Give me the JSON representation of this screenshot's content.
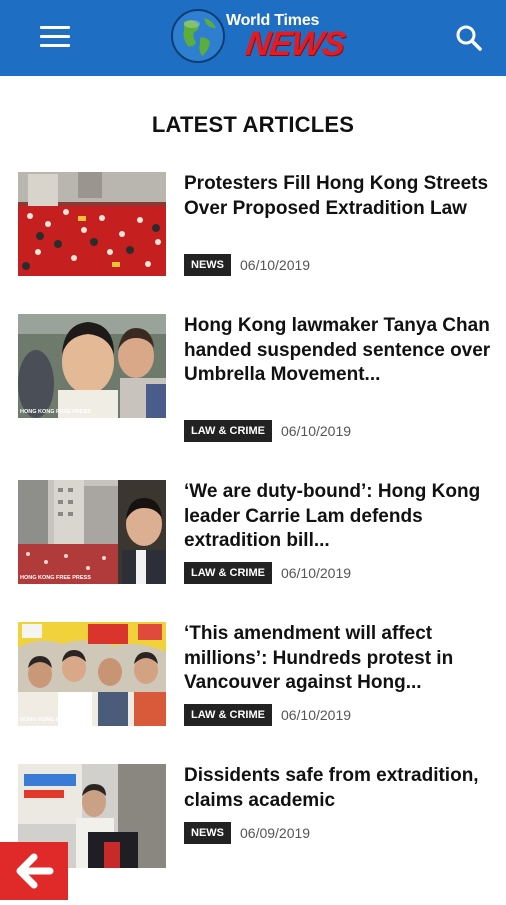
{
  "header": {
    "menu_icon": "hamburger-menu-icon",
    "logo_top": "World Times",
    "logo_news": "NEWS",
    "search_icon": "search-icon",
    "bar_color": "#1e6fc4"
  },
  "section": {
    "title": "LATEST ARTICLES"
  },
  "articles": [
    {
      "title": "Protesters Fill Hong Kong Streets Over Proposed Extradition Law",
      "category": "NEWS",
      "date": "06/10/2019",
      "thumb_caption": ""
    },
    {
      "title": "Hong Kong lawmaker Tanya Chan handed suspended sentence over Umbrella Movement...",
      "category": "LAW & CRIME",
      "date": "06/10/2019",
      "thumb_caption": "HONG KONG FREE PRESS"
    },
    {
      "title": "‘We are duty-bound’: Hong Kong leader Carrie Lam defends extradition bill...",
      "category": "LAW & CRIME",
      "date": "06/10/2019",
      "thumb_caption": "HONG KONG FREE PRESS"
    },
    {
      "title": "‘This amendment will affect millions’: Hundreds protest in Vancouver against Hong...",
      "category": "LAW & CRIME",
      "date": "06/10/2019",
      "thumb_caption": "HONG KONG FREE PRESS"
    },
    {
      "title": "Dissidents safe from extradition, claims academic",
      "category": "NEWS",
      "date": "06/09/2019",
      "thumb_caption": ""
    }
  ],
  "back_button": {
    "icon": "arrow-left-icon",
    "color": "#e02a2a"
  }
}
